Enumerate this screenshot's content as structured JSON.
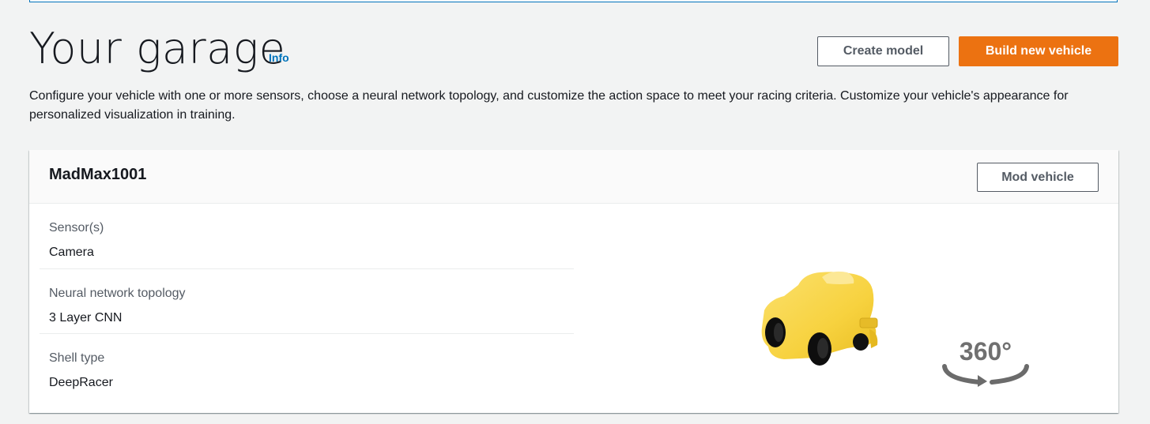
{
  "header": {
    "title": "Your garage",
    "info_link": "Info",
    "create_model_label": "Create model",
    "build_vehicle_label": "Build new vehicle",
    "description": "Configure your vehicle with one or more sensors, choose a neural network topology, and customize the action space to meet your racing criteria. Customize your vehicle's appearance for personalized visualization in training."
  },
  "vehicle": {
    "name": "MadMax1001",
    "mod_label": "Mod vehicle",
    "details": [
      {
        "label": "Sensor(s)",
        "value": "Camera"
      },
      {
        "label": "Neural network topology",
        "value": "3 Layer CNN"
      },
      {
        "label": "Shell type",
        "value": "DeepRacer"
      }
    ],
    "rotate_label": "360°",
    "shell_color": "#f9d64a"
  },
  "colors": {
    "primary_button": "#ec7211",
    "link": "#0073bb",
    "secondary_text": "#545b64"
  }
}
